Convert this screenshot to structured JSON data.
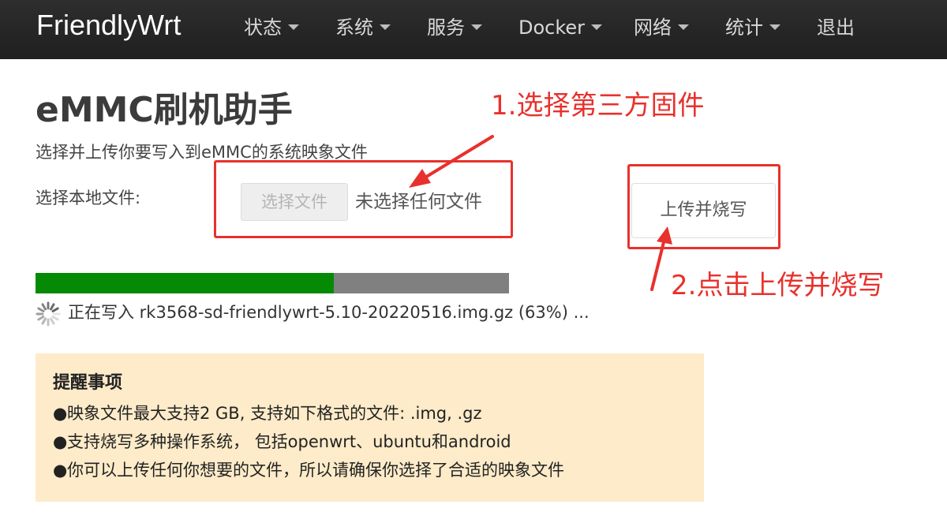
{
  "navbar": {
    "brand": "FriendlyWrt",
    "items": [
      {
        "label": "状态",
        "dropdown": true
      },
      {
        "label": "系统",
        "dropdown": true
      },
      {
        "label": "服务",
        "dropdown": true
      },
      {
        "label": "Docker",
        "dropdown": true
      },
      {
        "label": "网络",
        "dropdown": true
      },
      {
        "label": "统计",
        "dropdown": true
      },
      {
        "label": "退出",
        "dropdown": false
      }
    ]
  },
  "main": {
    "title": "eMMC刷机助手",
    "description": "选择并上传你要写入到eMMC的系统映象文件",
    "file_label": "选择本地文件:",
    "file_button": "选择文件",
    "file_status": "未选择任何文件",
    "upload_button": "上传并烧写"
  },
  "annotations": {
    "step1": "1.选择第三方固件",
    "step2": "2.点击上传并烧写",
    "color": "#e8312c"
  },
  "progress": {
    "percent": 63,
    "text": "正在写入 rk3568-sd-friendlywrt-5.10-20220516.img.gz (63%) ...",
    "fill_color": "#058a05",
    "track_color": "#808080"
  },
  "notice": {
    "title": "提醒事项",
    "items": [
      "映象文件最大支持2 GB, 支持如下格式的文件: .img, .gz",
      "支持烧写多种操作系统， 包括openwrt、ubuntu和android",
      "你可以上传任何你想要的文件，所以请确保你选择了合适的映象文件"
    ],
    "background": "#fdebc9"
  }
}
